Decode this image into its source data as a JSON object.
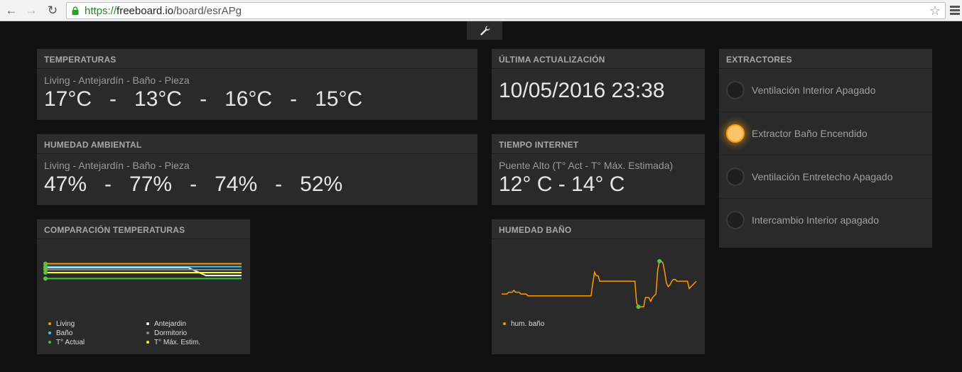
{
  "browser": {
    "url_scheme": "https://",
    "url_host": "freeboard.io",
    "url_path": "/board/esrAPg"
  },
  "board": {
    "temperaturas": {
      "header": "TEMPERATURAS",
      "subtitle": "Living - Antejardín - Baño - Pieza",
      "value": "17°C   -   13°C   -   16°C   -   15°C"
    },
    "humedad_ambiental": {
      "header": "HUMEDAD AMBIENTAL",
      "subtitle": "Living - Antejardín - Baño - Pieza",
      "value": "47%   -   77%   -   74%   -   52%"
    },
    "ultima_actualizacion": {
      "header": "ÚLTIMA ACTUALIZACIÓN",
      "value": "10/05/2016 23:38"
    },
    "tiempo_internet": {
      "header": "TIEMPO INTERNET",
      "subtitle": "Puente Alto (T° Act - T° Máx. Estimada)",
      "value": "12° C - 14° C"
    },
    "extractores": {
      "header": "EXTRACTORES",
      "items": [
        {
          "label": "Ventilación Interior Apagado",
          "on": false
        },
        {
          "label": "Extractor Baño Encendido",
          "on": true
        },
        {
          "label": "Ventilación Entretecho Apagado",
          "on": false
        },
        {
          "label": "Intercambio Interior apagado",
          "on": false
        }
      ]
    },
    "comparacion": {
      "header": "COMPARACIÓN TEMPERATURAS",
      "legend": [
        {
          "label": "Living",
          "color": "#ff9900"
        },
        {
          "label": "Antejardin",
          "color": "#ffffff"
        },
        {
          "label": "Baño",
          "color": "#33ccff"
        },
        {
          "label": "Dormitorio",
          "color": "#888888"
        },
        {
          "label": "T° Actual",
          "color": "#33cc33"
        },
        {
          "label": "T° Máx. Estim.",
          "color": "#ffff00"
        }
      ]
    },
    "humedad_bano": {
      "header": "HUMEDAD BAÑO",
      "legend": [
        {
          "label": "hum. baño",
          "color": "#ff9900"
        }
      ]
    }
  },
  "chart_data": [
    {
      "type": "line",
      "series": [
        {
          "name": "Living",
          "color": "#ff9900",
          "values": [
            17,
            17,
            17,
            17,
            17,
            17,
            17,
            17,
            17,
            17,
            17,
            17
          ]
        },
        {
          "name": "Antejardin",
          "color": "#ffffff",
          "values": [
            15.7,
            15.7,
            15.7,
            15.7,
            15.7,
            15.7,
            15.7,
            15.7,
            15.7,
            13,
            13,
            13
          ]
        },
        {
          "name": "Baño",
          "color": "#33ccff",
          "values": [
            16,
            16,
            16,
            16,
            16,
            16,
            16,
            16,
            16,
            16,
            16,
            16
          ]
        },
        {
          "name": "Dormitorio",
          "color": "#888888",
          "values": [
            15,
            15,
            15,
            15,
            15,
            15,
            15,
            15,
            15,
            15,
            15,
            15
          ]
        },
        {
          "name": "T° Actual",
          "color": "#33cc33",
          "values": [
            12,
            12,
            12,
            12,
            12,
            12,
            12,
            12,
            12,
            12,
            12,
            12
          ]
        },
        {
          "name": "T° Máx. Estim.",
          "color": "#ffff00",
          "values": [
            14,
            14,
            14,
            14,
            14,
            14,
            14,
            14,
            14,
            14,
            14,
            14
          ]
        }
      ],
      "ylim": [
        8,
        20
      ]
    },
    {
      "type": "line",
      "series": [
        {
          "name": "hum. baño",
          "color": "#ff9900",
          "values": [
            72,
            72,
            72,
            72,
            72,
            72,
            72,
            72,
            72,
            72,
            72,
            72,
            72,
            72,
            72,
            72,
            72,
            72,
            72,
            72,
            72,
            72,
            72,
            72,
            72,
            72,
            72,
            72,
            72,
            72,
            73,
            73,
            73,
            73,
            73,
            73,
            73,
            73,
            73,
            73,
            73,
            73,
            73,
            73,
            73,
            73,
            73,
            73,
            73,
            73,
            73,
            73,
            73,
            73,
            73,
            74,
            73,
            73,
            73,
            73,
            73,
            73,
            73,
            73,
            73,
            73,
            73,
            73,
            73,
            73,
            73,
            73,
            72,
            72,
            72,
            72,
            72,
            72,
            72,
            72,
            72,
            72,
            72,
            72,
            72,
            72,
            72,
            72,
            72,
            72,
            72,
            72,
            72,
            72,
            72,
            72,
            72,
            72,
            72,
            72,
            72,
            72,
            71,
            71,
            71,
            71,
            71,
            71,
            71,
            71,
            71,
            71,
            71,
            71,
            71,
            71,
            71,
            71,
            71,
            71,
            71,
            71,
            71,
            71,
            71,
            71,
            71,
            71,
            71,
            71,
            71,
            71,
            71,
            71,
            71,
            71,
            71,
            71,
            71,
            71,
            71,
            71,
            71,
            71,
            71,
            71,
            71,
            71,
            71,
            71,
            71,
            71,
            71,
            71,
            71,
            71,
            71,
            71,
            71,
            71,
            71,
            71,
            71,
            71,
            71,
            71,
            71,
            71,
            71,
            71,
            71,
            71,
            71,
            71,
            71,
            71,
            71,
            71,
            71,
            71,
            71,
            71,
            71,
            71,
            71,
            71,
            71,
            71,
            71,
            71,
            71,
            71,
            71,
            71,
            71,
            71,
            71,
            71,
            71,
            71,
            71,
            71,
            71,
            71,
            71,
            71,
            71,
            71,
            71,
            71
          ]
        }
      ],
      "points": [
        72,
        72,
        72,
        72,
        73,
        73,
        73,
        74,
        73,
        73,
        73,
        72,
        72,
        72,
        72,
        71,
        71,
        71,
        71,
        71,
        71,
        71,
        71,
        71,
        71,
        71,
        71,
        71,
        71,
        71,
        71,
        71,
        71,
        71,
        71,
        71,
        71,
        71,
        71,
        71,
        71,
        71,
        71,
        71,
        71,
        71,
        71,
        71,
        71,
        71,
        71,
        71,
        78,
        84,
        82,
        82,
        79,
        79,
        79,
        79,
        79,
        79,
        79,
        79,
        79,
        79,
        79,
        79,
        79,
        79,
        79,
        79,
        79,
        79,
        79,
        79,
        79,
        67,
        65,
        65,
        65,
        65,
        70,
        70,
        70,
        68,
        70,
        71,
        72,
        85,
        90,
        90,
        89,
        84,
        78,
        76,
        77,
        79,
        80,
        80,
        79,
        79,
        79,
        79,
        79,
        79,
        79,
        75,
        76,
        77,
        78,
        79
      ],
      "ylim": [
        60,
        95
      ]
    }
  ]
}
